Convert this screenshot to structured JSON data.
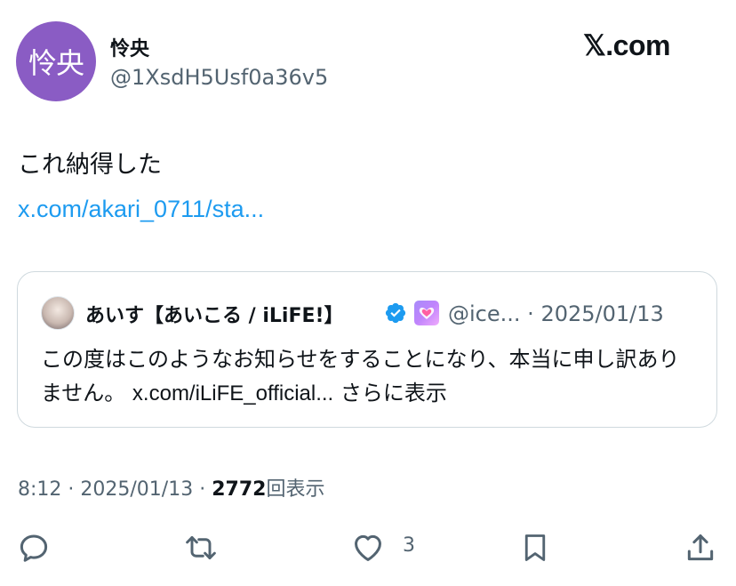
{
  "author": {
    "avatar_text": "怜央",
    "avatar_color": "#8a5cc4",
    "display_name": "怜央",
    "handle": "@1XsdH5Usf0a36v5"
  },
  "site": {
    "logo_text": "𝕏.com"
  },
  "tweet": {
    "text": "これ納得した",
    "link": "x.com/akari_0711/sta..."
  },
  "quote": {
    "name": "あいす【あいこる / iLiFE!】",
    "handle": "@ice...",
    "separator": "·",
    "date": "2025/01/13",
    "text": "この度はこのようなお知らせをすることになり、本当に申し訳ありません。",
    "link": "x.com/iLiFE_official...",
    "show_more": "さらに表示"
  },
  "meta": {
    "time": "8:12",
    "separator": "·",
    "date": "2025/01/13",
    "views_count": "2772",
    "views_label": "回表示"
  },
  "actions": {
    "like_count": "3"
  },
  "colors": {
    "link": "#1d9bf0",
    "secondary_text": "#536471",
    "primary_text": "#0f1419",
    "verified": "#1d9bf0",
    "border": "#cfd9de"
  }
}
